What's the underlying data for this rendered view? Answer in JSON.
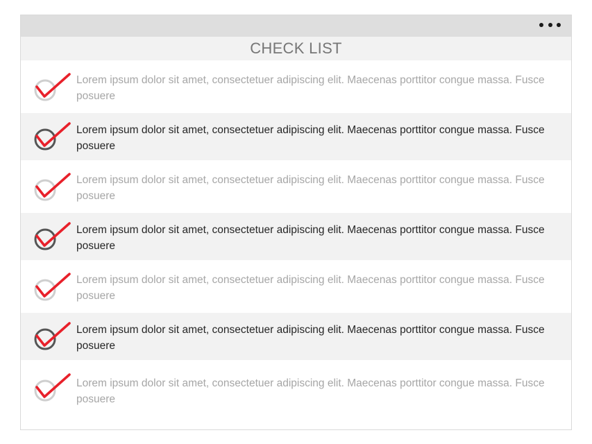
{
  "window": {
    "menu_icon": "more-horizontal-icon"
  },
  "header": {
    "title": "CHECK LIST"
  },
  "colors": {
    "check_mark": "#e8202a",
    "circle_checked": "#555555",
    "circle_unchecked": "#cfcfcf",
    "text_checked": "#262626",
    "text_unchecked": "#a6a6a6",
    "alt_row_bg": "#f2f2f2"
  },
  "items": [
    {
      "text": "Lorem ipsum dolor sit amet, consectetuer  adipiscing elit. Maecenas porttitor congue massa. Fusce posuere",
      "checked": false
    },
    {
      "text": "Lorem ipsum dolor sit amet, consectetuer  adipiscing elit. Maecenas porttitor congue massa. Fusce posuere",
      "checked": true
    },
    {
      "text": "Lorem ipsum dolor sit amet, consectetuer  adipiscing elit. Maecenas porttitor congue massa. Fusce posuere",
      "checked": false
    },
    {
      "text": "Lorem ipsum dolor sit amet, consectetuer  adipiscing elit. Maecenas porttitor congue massa. Fusce posuere",
      "checked": true
    },
    {
      "text": "Lorem ipsum dolor sit amet, consectetuer  adipiscing elit. Maecenas porttitor congue massa. Fusce posuere",
      "checked": false
    },
    {
      "text": "Lorem ipsum dolor sit amet, consectetuer  adipiscing elit. Maecenas porttitor congue massa. Fusce posuere",
      "checked": true
    },
    {
      "text": "Lorem ipsum dolor sit amet, consectetuer  adipiscing elit. Maecenas porttitor congue massa. Fusce posuere",
      "checked": false
    }
  ]
}
